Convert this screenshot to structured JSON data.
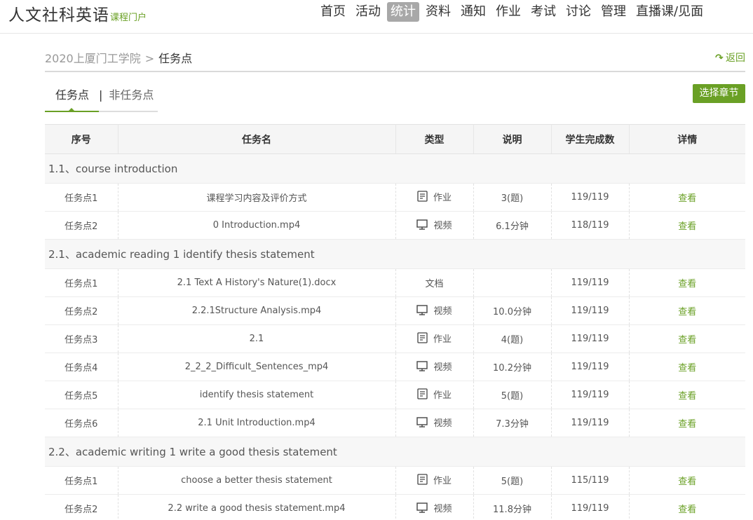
{
  "header": {
    "title": "人文社科英语",
    "subtitle": "课程门户",
    "nav": [
      {
        "label": "首页",
        "active": false
      },
      {
        "label": "活动",
        "active": false
      },
      {
        "label": "统计",
        "active": true
      },
      {
        "label": "资料",
        "active": false
      },
      {
        "label": "通知",
        "active": false
      },
      {
        "label": "作业",
        "active": false
      },
      {
        "label": "考试",
        "active": false
      },
      {
        "label": "讨论",
        "active": false
      },
      {
        "label": "管理",
        "active": false
      },
      {
        "label": "直播课/见面",
        "active": false
      }
    ]
  },
  "breadcrumb": {
    "parent": "2020上厦门工学院",
    "separator": ">",
    "current": "任务点",
    "back_label": "返回"
  },
  "tabs": {
    "tab_a": "任务点",
    "divider": "|",
    "tab_b": "非任务点"
  },
  "select_button": "选择章节",
  "table": {
    "columns": [
      "序号",
      "任务名",
      "类型",
      "说明",
      "学生完成数",
      "详情"
    ],
    "sections": [
      {
        "title": "1.1、course introduction",
        "rows": [
          {
            "index": "任务点1",
            "name": "课程学习内容及评价方式",
            "type": "作业",
            "icon": "homework-icon",
            "note": "3(题)",
            "completed": "119/119",
            "detail": "查看"
          },
          {
            "index": "任务点2",
            "name": "0 Introduction.mp4",
            "type": "视频",
            "icon": "video-icon",
            "note": "6.1分钟",
            "completed": "118/119",
            "detail": "查看"
          }
        ]
      },
      {
        "title": "2.1、academic reading 1 identify thesis statement",
        "rows": [
          {
            "index": "任务点1",
            "name": "2.1 Text A History's Nature(1).docx",
            "type": "文档",
            "icon": "",
            "note": "",
            "completed": "119/119",
            "detail": "查看"
          },
          {
            "index": "任务点2",
            "name": "2.2.1Structure Analysis.mp4",
            "type": "视频",
            "icon": "video-icon",
            "note": "10.0分钟",
            "completed": "119/119",
            "detail": "查看"
          },
          {
            "index": "任务点3",
            "name": "2.1",
            "type": "作业",
            "icon": "homework-icon",
            "note": "4(题)",
            "completed": "119/119",
            "detail": "查看"
          },
          {
            "index": "任务点4",
            "name": "2_2_2_Difficult_Sentences_mp4",
            "type": "视频",
            "icon": "video-icon",
            "note": "10.2分钟",
            "completed": "119/119",
            "detail": "查看"
          },
          {
            "index": "任务点5",
            "name": "identify thesis statement",
            "type": "作业",
            "icon": "homework-icon",
            "note": "5(题)",
            "completed": "119/119",
            "detail": "查看"
          },
          {
            "index": "任务点6",
            "name": "2.1 Unit Introduction.mp4",
            "type": "视频",
            "icon": "video-icon",
            "note": "7.3分钟",
            "completed": "119/119",
            "detail": "查看"
          }
        ]
      },
      {
        "title": "2.2、academic writing 1 write a good thesis statement",
        "rows": [
          {
            "index": "任务点1",
            "name": "choose a better thesis statement",
            "type": "作业",
            "icon": "homework-icon",
            "note": "5(题)",
            "completed": "115/119",
            "detail": "查看"
          },
          {
            "index": "任务点2",
            "name": "2.2 write a good thesis statement.mp4",
            "type": "视频",
            "icon": "video-icon",
            "note": "11.8分钟",
            "completed": "119/119",
            "detail": "查看"
          }
        ]
      }
    ]
  },
  "colors": {
    "accent": "#6aa025",
    "nav_active_bg": "#a8a8a8",
    "header_bg": "#f5f5f5"
  }
}
